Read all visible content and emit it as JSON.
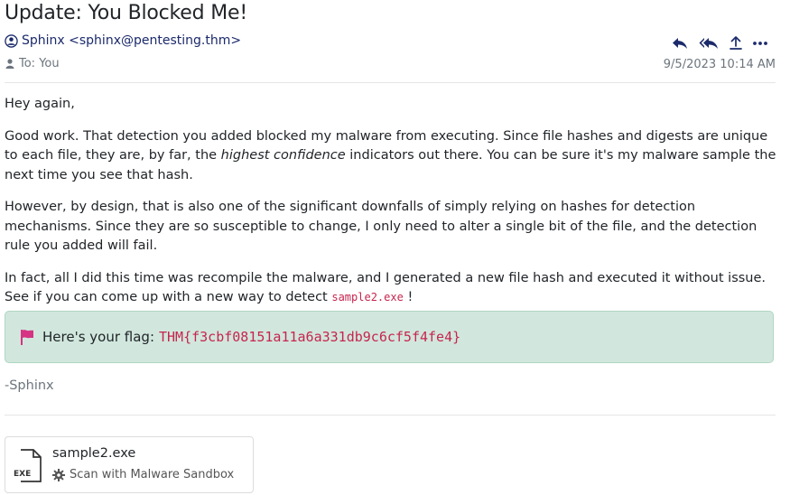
{
  "email": {
    "subject": "Update: You Blocked Me!",
    "sender": "Sphinx <sphinx@pentesting.thm>",
    "to": "To: You",
    "timestamp": "9/5/2023 10:14 AM"
  },
  "body": {
    "greeting": "Hey again,",
    "p1_a": "Good work. That detection you added blocked my malware from executing. Since file hashes and digests are unique to each file, they are, by far, the ",
    "p1_em": "highest confidence",
    "p1_b": " indicators out there. You can be sure it's my malware sample the next time you see that hash.",
    "p2": "However, by design, that is also one of the significant downfalls of simply relying on hashes for detection mechanisms. Since they are so susceptible to change, I only need to alter a single bit of the file, and the detection rule you added will fail.",
    "p3_a": "In fact, all I did this time was recompile the malware, and I generated a new file hash and executed it without issue. See if you can come up with a new way to detect ",
    "p3_code": "sample2.exe",
    "p3_b": " !"
  },
  "flag": {
    "label": "Here's your flag:",
    "value": "THM{f3cbf08151a11a6a331db9c6cf5f4fe4}"
  },
  "signature": "-Sphinx",
  "attachment": {
    "file_name": "sample2.exe",
    "icon_text": "EXE",
    "scan_label": "Scan with Malware Sandbox"
  },
  "icons": {
    "avatar": "user-circle-icon",
    "to": "person-icon",
    "reply": "reply-icon",
    "reply_all": "reply-all-icon",
    "forward": "upload-icon",
    "more": "more-icon",
    "flag": "flag-icon",
    "file": "exe-file-icon",
    "scan": "gear-icon"
  },
  "colors": {
    "accent": "#1b2a6b",
    "flag_bg": "#d1e7dd",
    "flag_text": "#c7254e",
    "flag_icon": "#d63384"
  }
}
